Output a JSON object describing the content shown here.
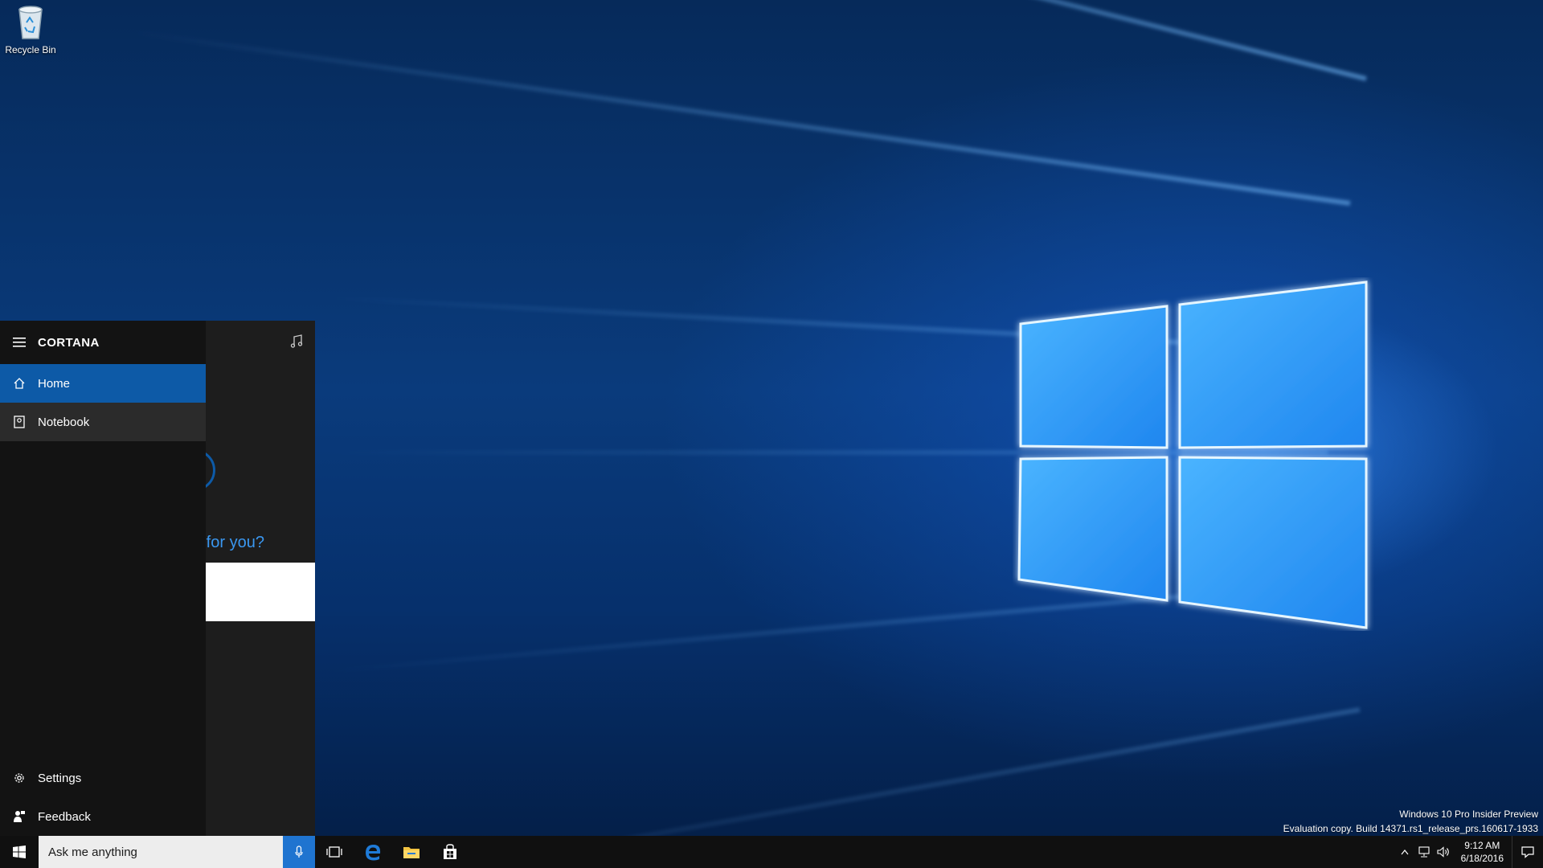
{
  "desktop": {
    "recycle_bin_label": "Recycle Bin",
    "watermark": {
      "line1": "Windows 10 Pro Insider Preview",
      "line2": "Evaluation copy. Build 14371.rs1_release_prs.160617-1933"
    }
  },
  "cortana": {
    "title": "CORTANA",
    "nav_items": [
      {
        "label": "Home",
        "icon": "home-icon",
        "state": "active"
      },
      {
        "label": "Notebook",
        "icon": "notebook-icon",
        "state": "hover"
      }
    ],
    "bottom_items": [
      {
        "label": "Settings",
        "icon": "gear-icon"
      },
      {
        "label": "Feedback",
        "icon": "feedback-icon"
      }
    ],
    "greeting_partial": "o for you?",
    "accent_color": "#0d5aa7"
  },
  "taskbar": {
    "search_placeholder": "Ask me anything",
    "pinned": [
      "task-view-icon",
      "edge-icon",
      "file-explorer-icon",
      "store-icon"
    ],
    "clock": {
      "time": "9:12 AM",
      "date": "6/18/2016"
    }
  }
}
